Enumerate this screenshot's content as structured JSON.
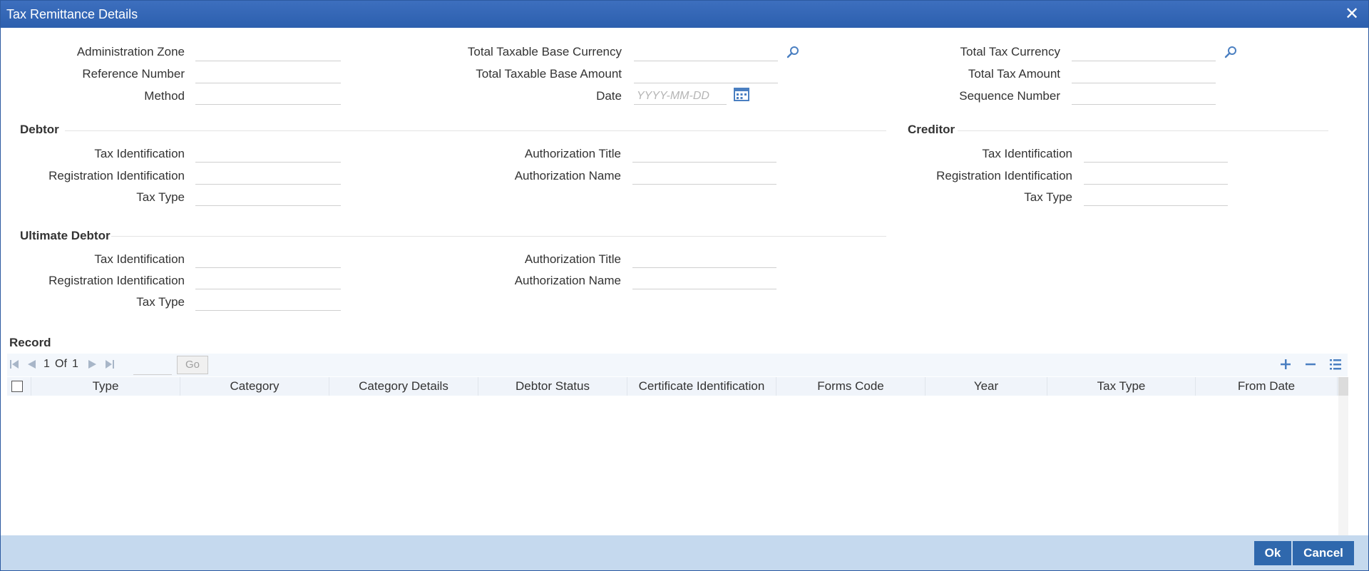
{
  "window": {
    "title": "Tax Remittance Details"
  },
  "fields": {
    "administration_zone": "Administration Zone",
    "reference_number": "Reference Number",
    "method": "Method",
    "total_taxable_base_currency": "Total Taxable Base Currency",
    "total_taxable_base_amount": "Total Taxable Base Amount",
    "date": "Date",
    "date_placeholder": "YYYY-MM-DD",
    "total_tax_currency": "Total Tax Currency",
    "total_tax_amount": "Total Tax Amount",
    "sequence_number": "Sequence Number"
  },
  "debtor": {
    "title": "Debtor",
    "tax_identification": "Tax Identification",
    "registration_identification": "Registration Identification",
    "tax_type": "Tax Type",
    "authorization_title": "Authorization Title",
    "authorization_name": "Authorization Name"
  },
  "creditor": {
    "title": "Creditor",
    "tax_identification": "Tax Identification",
    "registration_identification": "Registration Identification",
    "tax_type": "Tax Type"
  },
  "ultimate_debtor": {
    "title": "Ultimate Debtor",
    "tax_identification": "Tax Identification",
    "registration_identification": "Registration Identification",
    "tax_type": "Tax Type",
    "authorization_title": "Authorization Title",
    "authorization_name": "Authorization Name"
  },
  "record": {
    "title": "Record",
    "page_current": "1",
    "page_of": "Of",
    "page_total": "1",
    "go_label": "Go",
    "columns": [
      "Type",
      "Category",
      "Category Details",
      "Debtor Status",
      "Certificate Identification",
      "Forms Code",
      "Year",
      "Tax Type",
      "From Date"
    ]
  },
  "footer": {
    "ok_label": "Ok",
    "cancel_label": "Cancel"
  },
  "icons": {
    "search": "search-icon",
    "calendar": "calendar-icon",
    "first": "first-page-icon",
    "prev": "prev-page-icon",
    "next": "next-page-icon",
    "last": "last-page-icon",
    "add": "add-row-icon",
    "delete": "delete-row-icon",
    "single_view": "single-record-view-icon"
  },
  "colors": {
    "titlebar": "#2c5fae",
    "footer": "#c5d9ee",
    "button": "#2f68ad",
    "icon": "#4a7fc1"
  }
}
